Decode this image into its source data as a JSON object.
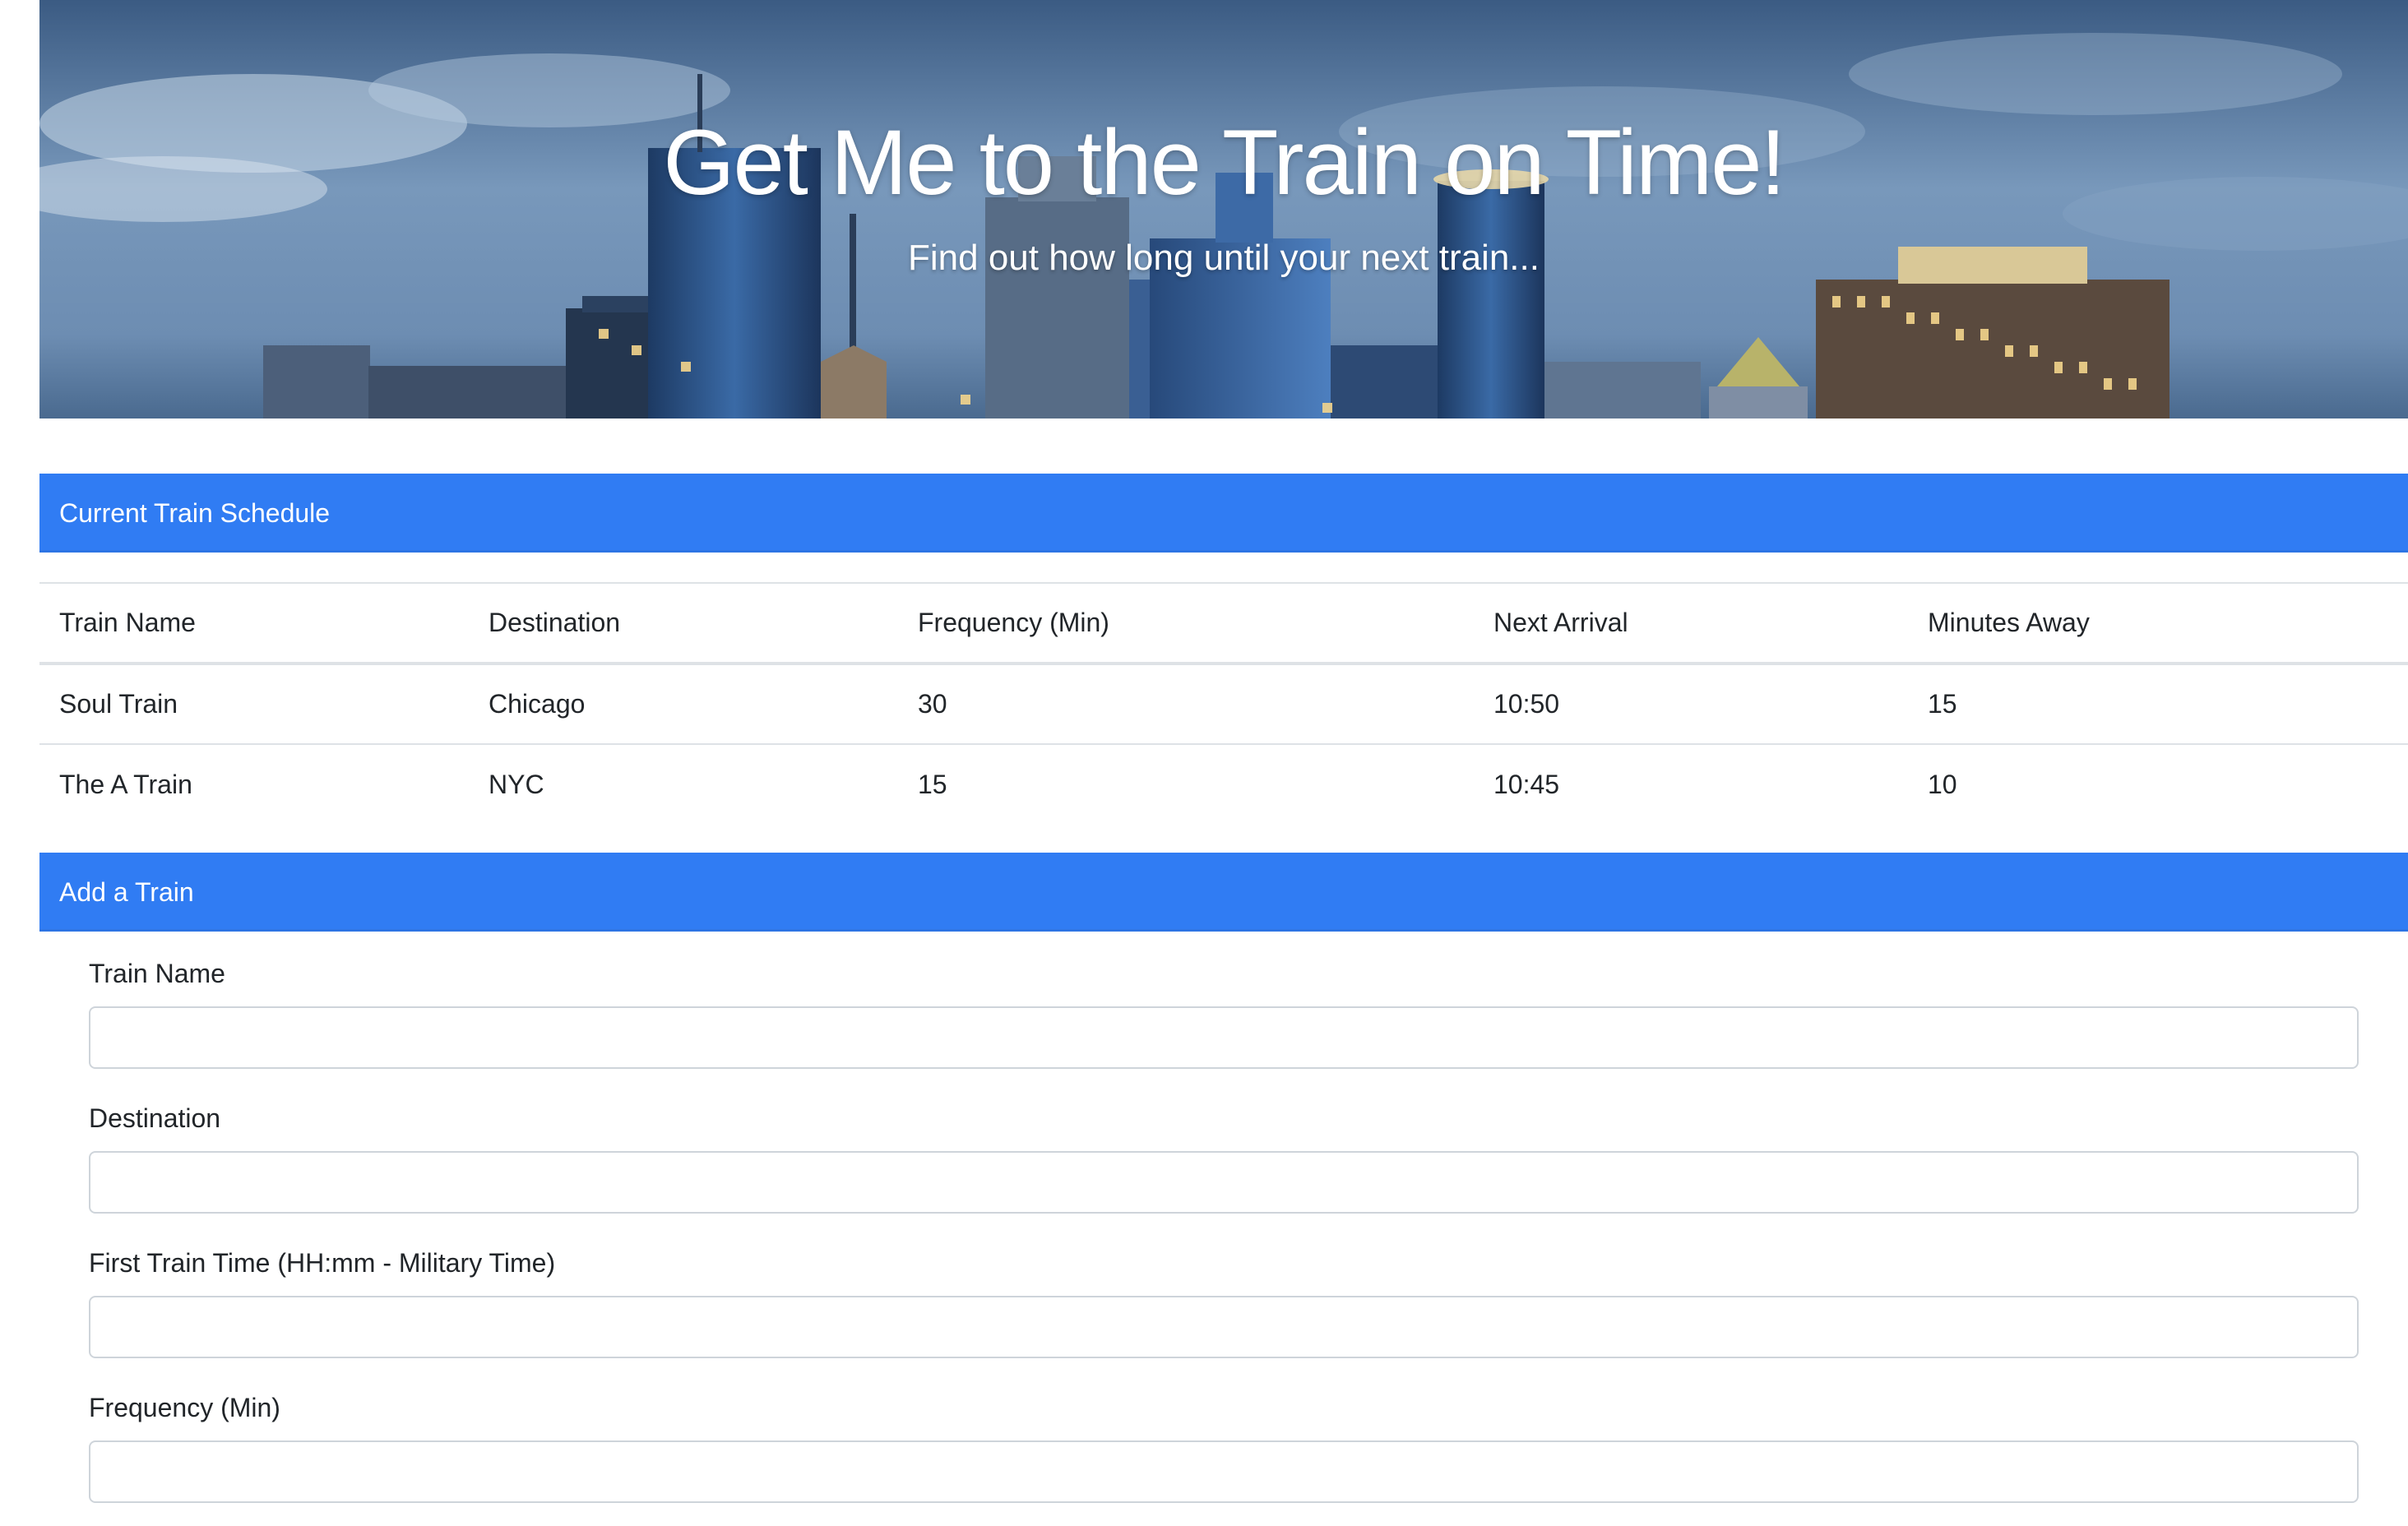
{
  "hero": {
    "title": "Get Me to the Train on Time!",
    "subtitle": "Find out how long until your next train..."
  },
  "schedule": {
    "header": "Current Train Schedule",
    "columns": [
      "Train Name",
      "Destination",
      "Frequency (Min)",
      "Next Arrival",
      "Minutes Away"
    ],
    "rows": [
      [
        "Soul Train",
        "Chicago",
        "30",
        "10:50",
        "15"
      ],
      [
        "The A Train",
        "NYC",
        "15",
        "10:45",
        "10"
      ]
    ]
  },
  "add_train": {
    "header": "Add a Train",
    "fields": [
      {
        "label": "Train Name",
        "value": ""
      },
      {
        "label": "Destination",
        "value": ""
      },
      {
        "label": "First Train Time (HH:mm - Military Time)",
        "value": ""
      },
      {
        "label": "Frequency (Min)",
        "value": ""
      }
    ]
  },
  "colors": {
    "accent": "#307cf3",
    "table_border": "#dee2e6",
    "input_border": "#ced4da"
  }
}
